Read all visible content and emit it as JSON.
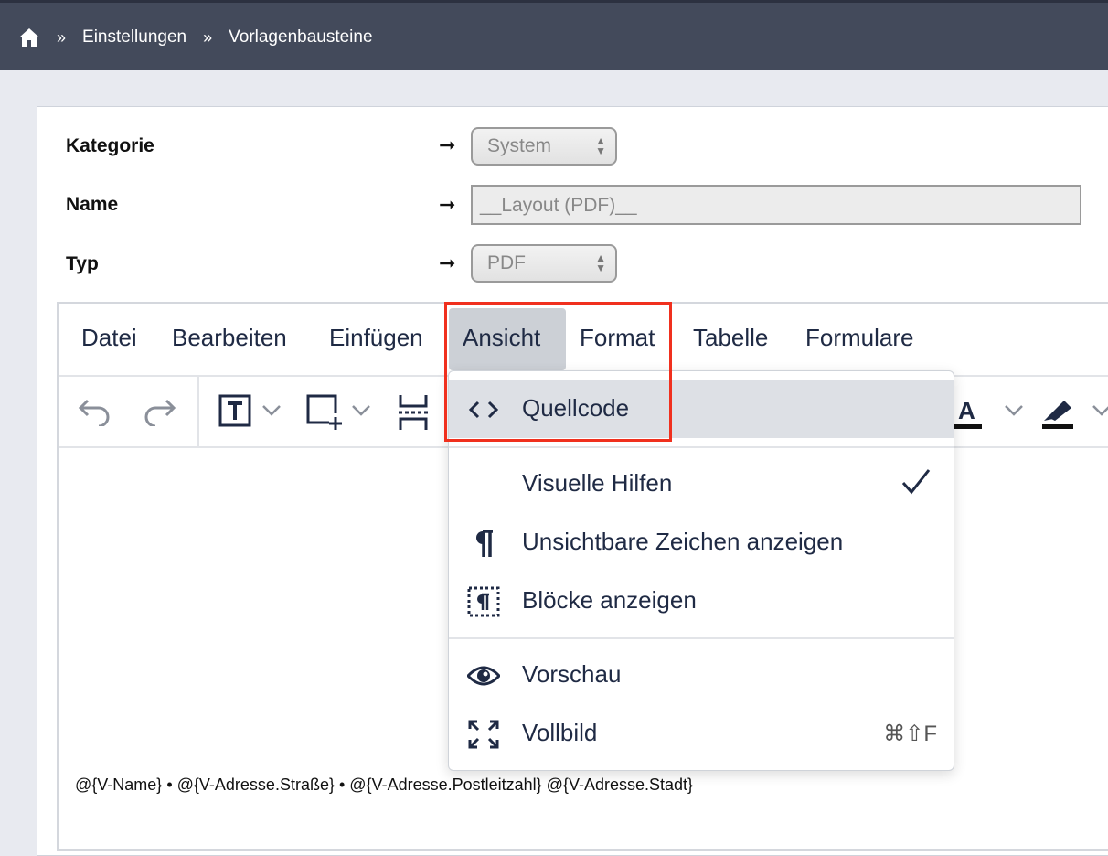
{
  "breadcrumb": {
    "items": [
      "Einstellungen",
      "Vorlagenbausteine"
    ],
    "separator": "»"
  },
  "form": {
    "kategorie": {
      "label": "Kategorie",
      "value": "System"
    },
    "name": {
      "label": "Name",
      "value": "__Layout (PDF)__"
    },
    "typ": {
      "label": "Typ",
      "value": "PDF"
    },
    "arrow": "➞"
  },
  "editor": {
    "menu": [
      "Datei",
      "Bearbeiten",
      "Einfügen",
      "Ansicht",
      "Format",
      "Tabelle",
      "Formulare"
    ],
    "active_menu": "Ansicht",
    "content_line": "@{V-Name} • @{V-Adresse.Straße} • @{V-Adresse.Postleitzahl} @{V-Adresse.Stadt}"
  },
  "dropdown": {
    "items": [
      {
        "label": "Quellcode",
        "icon": "code-icon",
        "highlighted": true
      },
      {
        "label": "Visuelle Hilfen",
        "icon": "",
        "checked": true
      },
      {
        "label": "Unsichtbare Zeichen anzeigen",
        "icon": "pilcrow-icon"
      },
      {
        "label": "Blöcke anzeigen",
        "icon": "show-blocks-icon"
      },
      {
        "label": "Vorschau",
        "icon": "eye-icon"
      },
      {
        "label": "Vollbild",
        "icon": "fullscreen-icon",
        "shortcut": "⌘⇧F"
      }
    ]
  },
  "colors": {
    "topbar": "#434a5b",
    "highlight_box": "#f0301e",
    "menu_active": "#ccd0d6",
    "text_dark": "#1f2a44"
  }
}
